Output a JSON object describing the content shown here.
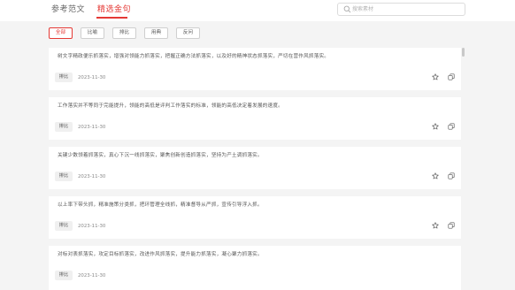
{
  "tabs": [
    {
      "label": "参考范文",
      "active": false
    },
    {
      "label": "精选金句",
      "active": true
    }
  ],
  "search": {
    "placeholder": "搜索素材",
    "value": ""
  },
  "filters": [
    {
      "label": "全部",
      "active": true
    },
    {
      "label": "比喻",
      "active": false
    },
    {
      "label": "排比",
      "active": false
    },
    {
      "label": "用典",
      "active": false
    },
    {
      "label": "反问",
      "active": false
    }
  ],
  "cards": [
    {
      "text": "树文字精政便乐抓落实，增强对领能力抓落实，把握正确方法抓落实，以及好的精神状态抓落实，严切在营作风抓落实。",
      "tag": "排比",
      "date": "2023-11-30"
    },
    {
      "text": "工作落实并不等同于完能提升，领能的高低是评判工作落实的标准，领能的高低决定着发展的速度。",
      "tag": "排比",
      "date": "2023-11-30"
    },
    {
      "text": "关键少数领着抓落实，真心下沉一线抓落实，聚焦创新创造抓落实，坚持为产土调抓落实。",
      "tag": "排比",
      "date": "2023-11-30"
    },
    {
      "text": "以上率下带头抓，精准施策分类抓，把环管理全线抓，精准督导从严抓，宣传引导浮入抓。",
      "tag": "排比",
      "date": "2023-11-30"
    },
    {
      "text": "对标对表抓落实，攻定目标抓落实，改进作风抓落实，提升能力抓落实，凝心聚力抓落实。",
      "tag": "排比",
      "date": "2023-11-30"
    }
  ],
  "icons": {
    "search": "search-icon",
    "star": "star-icon",
    "copy": "copy-icon"
  },
  "colors": {
    "accent": "#e53935",
    "background": "#f4f4f4",
    "card": "#ffffff"
  }
}
